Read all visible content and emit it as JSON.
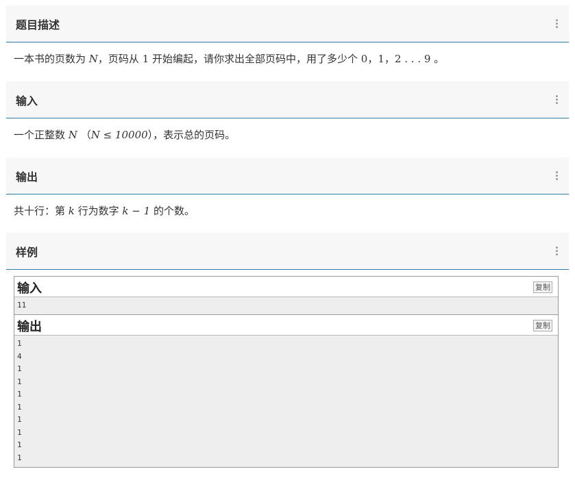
{
  "sections": {
    "description": {
      "title": "题目描述",
      "body_prefix": "一本书的页数为 ",
      "var_n": "N",
      "body_mid1": "，页码从 ",
      "one": "1",
      "body_mid2": " 开始编起，请你求出全部页码中，用了多少个 ",
      "zero": "0",
      "sep1": "，",
      "one_b": "1",
      "sep2": "，",
      "range": "2 . . . 9",
      "body_end": " 。"
    },
    "input": {
      "title": "输入",
      "body_prefix": "一个正整数 ",
      "var_n": "N",
      "paren_open": "（",
      "constraint": "N ≤ 10000",
      "paren_close": "），表示总的页码。"
    },
    "output": {
      "title": "输出",
      "body_prefix": "共十行：第 ",
      "var_k": "k",
      "body_mid": " 行为数字 ",
      "expr": "k − 1",
      "body_end": " 的个数。"
    },
    "sample": {
      "title": "样例"
    }
  },
  "sample": {
    "input_label": "输入",
    "output_label": "输出",
    "copy_label": "复制",
    "input_lines": [
      "11"
    ],
    "output_lines": [
      "1",
      "4",
      "1",
      "1",
      "1",
      "1",
      "1",
      "1",
      "1",
      "1"
    ]
  }
}
